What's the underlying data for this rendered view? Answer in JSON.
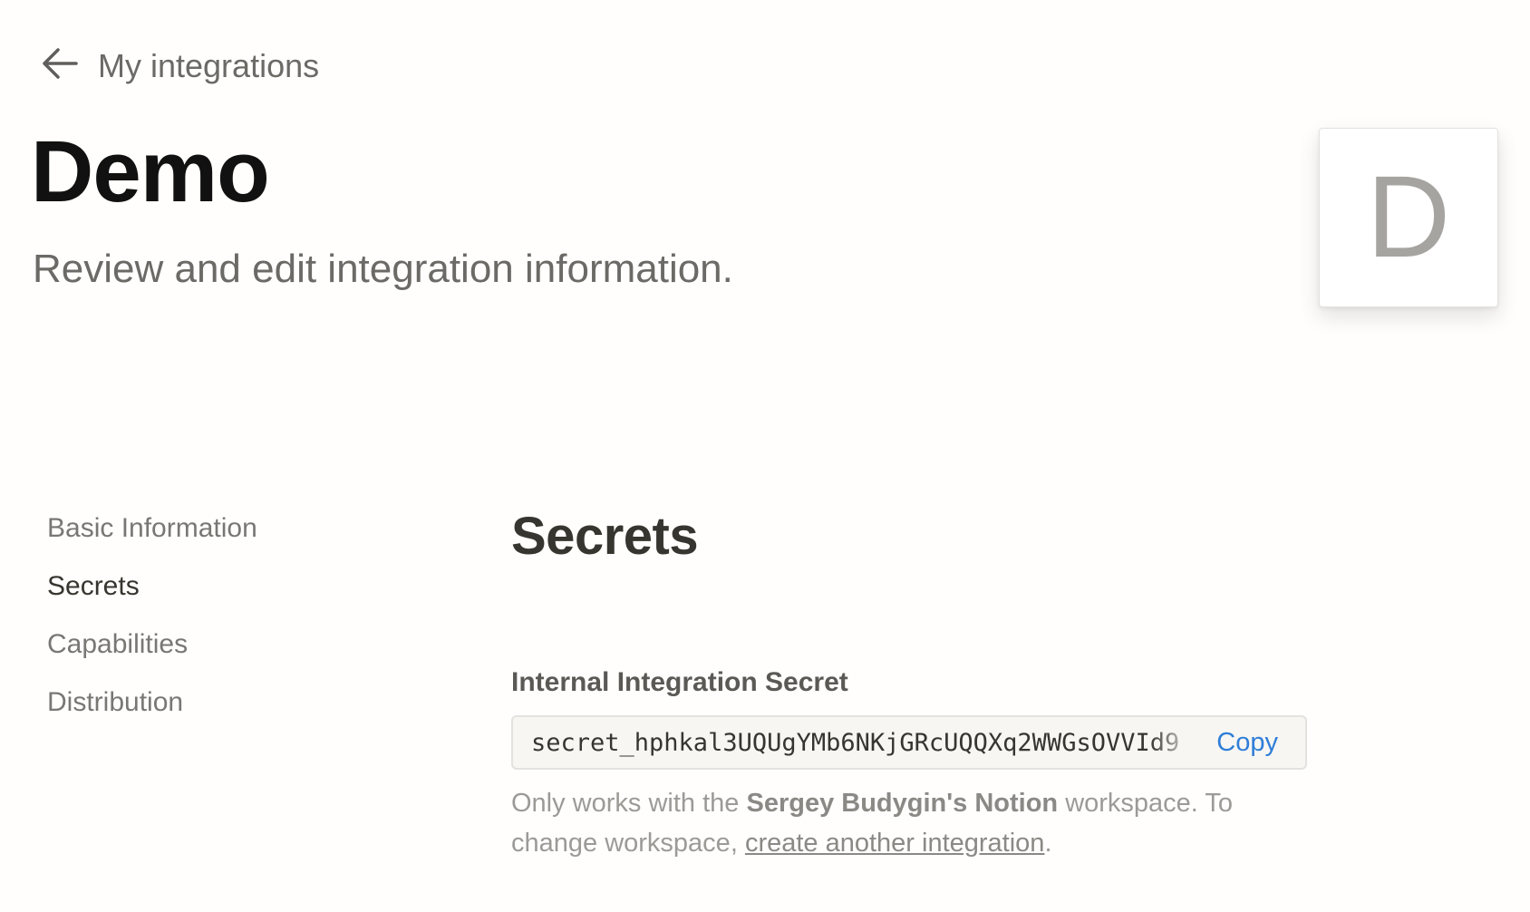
{
  "header": {
    "back_label": "My integrations",
    "title": "Demo",
    "subtitle": "Review and edit integration information.",
    "avatar_letter": "D"
  },
  "sidebar": {
    "items": [
      {
        "label": "Basic Information",
        "active": false
      },
      {
        "label": "Secrets",
        "active": true
      },
      {
        "label": "Capabilities",
        "active": false
      },
      {
        "label": "Distribution",
        "active": false
      }
    ]
  },
  "main": {
    "section_title": "Secrets",
    "field_label": "Internal Integration Secret",
    "secret_value": "secret_hphkal3UQUgYMb6NKjGRcUQQXq2WWGsOVVId9",
    "copy_label": "Copy",
    "help": {
      "prefix": "Only works with the ",
      "workspace": "Sergey Budygin's Notion",
      "middle": " workspace. To change workspace, ",
      "link": "create another integration",
      "suffix": "."
    }
  },
  "colors": {
    "accent": "#2f7ed8",
    "text": "#37352f",
    "muted": "#787774",
    "background": "#fffefc"
  }
}
